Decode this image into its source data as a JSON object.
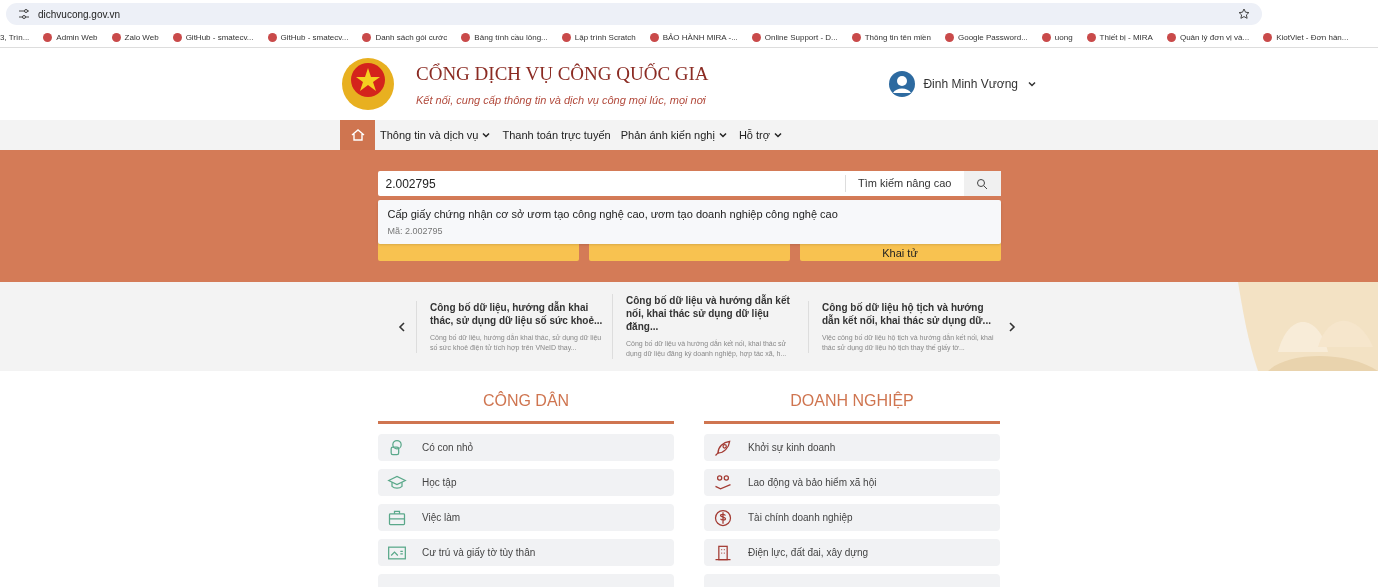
{
  "browser": {
    "url": "dichvucong.gov.vn",
    "bookmarks": [
      "3, Trìn...",
      "Admin Web",
      "Zalo Web",
      "GitHub - smatecv...",
      "GitHub - smatecv...",
      "Danh sách gói cước",
      "Bảng tính cầu lông...",
      "Lập trình Scratch",
      "BẢO HÀNH MIRA -...",
      "Online Support - D...",
      "Thông tin tên miền",
      "Google Password...",
      "uong",
      "Thiết bị - MIRA",
      "Quản lý đơn vị và...",
      "KiotViet - Đơn hàn..."
    ]
  },
  "header": {
    "title": "CỔNG DỊCH VỤ CÔNG QUỐC GIA",
    "tagline": "Kết nối, cung cấp thông tin và dịch vụ công mọi lúc, mọi nơi",
    "user": "Đinh Minh Vương"
  },
  "nav": [
    {
      "label": "Thông tin và dịch vụ",
      "dropdown": true
    },
    {
      "label": "Thanh toán trực tuyến",
      "dropdown": false
    },
    {
      "label": "Phản ánh kiến nghị",
      "dropdown": true
    },
    {
      "label": "Hỗ trợ",
      "dropdown": true
    }
  ],
  "search": {
    "value": "2.002795",
    "advanced": "Tìm kiếm nâng cao",
    "suggestion": {
      "title": "Cấp giấy chứng nhận cơ sở ươm tạo công nghệ cao, ươm tạo doanh nghiệp công nghệ cao",
      "code": "Mã: 2.002795"
    }
  },
  "quick_buttons": [
    {
      "kind": "hidden"
    },
    {
      "kind": "hidden"
    },
    {
      "kind": "labeled",
      "label": "Khai tử"
    }
  ],
  "news": [
    {
      "title": "Công bố dữ liệu, hướng dẫn khai thác, sử dụng dữ liệu số sức khoẻ...",
      "summary": "Công bố dữ liệu, hướng dẫn khai thác, sử dụng dữ liệu số sức khoẻ điện tử tích hợp trên VNeID thay..."
    },
    {
      "title": "Công bố dữ liệu và hướng dẫn kết nối, khai thác sử dụng dữ liệu đăng...",
      "summary": "Công bố dữ liệu và hướng dẫn kết nối, khai thác sử dụng dữ liệu đăng ký doanh nghiệp, hợp tác xã, h..."
    },
    {
      "title": "Công bố dữ liệu hộ tịch và hướng dẫn kết nối, khai thác sử dụng dữ...",
      "summary": "Việc công bố dữ liệu hộ tịch và hướng dẫn kết nối, khai thác sử dụng dữ liệu hộ tịch thay thế giấy tờ..."
    }
  ],
  "sections": [
    {
      "title": "CÔNG DÂN",
      "items": [
        {
          "label": "Có con nhỏ"
        },
        {
          "label": "Học tập"
        },
        {
          "label": "Việc làm"
        },
        {
          "label": "Cư trú và giấy tờ tùy thân"
        }
      ]
    },
    {
      "title": "DOANH NGHIỆP",
      "items": [
        {
          "label": "Khởi sự kinh doanh"
        },
        {
          "label": "Lao động và bảo hiểm xã hội"
        },
        {
          "label": "Tài chính doanh nghiệp"
        },
        {
          "label": "Điện lực, đất đai, xây dựng"
        }
      ]
    }
  ]
}
